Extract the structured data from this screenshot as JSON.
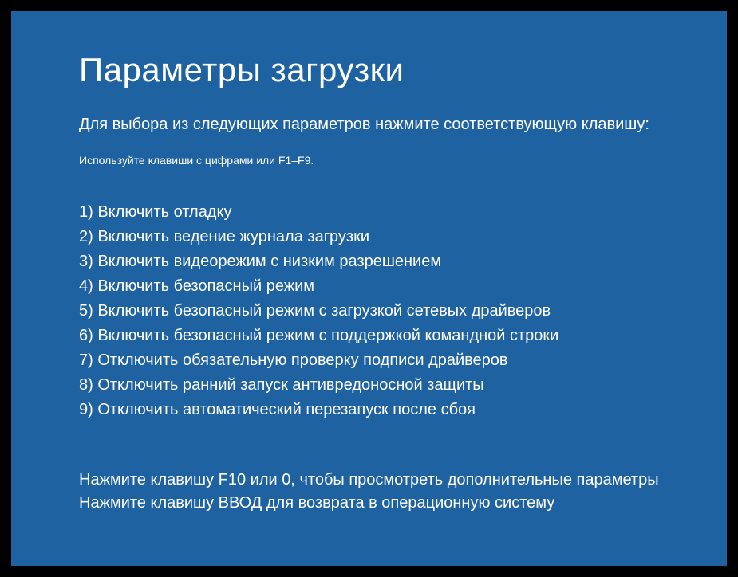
{
  "title": "Параметры загрузки",
  "subtitle": "Для выбора из следующих параметров нажмите соответствующую клавишу:",
  "hint": "Используйте клавиши с цифрами или F1–F9.",
  "options": [
    "1) Включить отладку",
    "2) Включить ведение журнала загрузки",
    "3) Включить видеорежим с низким разрешением",
    "4) Включить безопасный режим",
    "5) Включить безопасный режим с загрузкой сетевых драйверов",
    "6) Включить безопасный режим с поддержкой командной строки",
    "7) Отключить обязательную проверку подписи драйверов",
    "8) Отключить ранний запуск антивредоносной защиты",
    "9) Отключить автоматический перезапуск после сбоя"
  ],
  "footer": {
    "line1": "Нажмите клавишу F10 или 0, чтобы просмотреть дополнительные параметры",
    "line2": "Нажмите клавишу ВВОД для возврата в операционную систему"
  }
}
